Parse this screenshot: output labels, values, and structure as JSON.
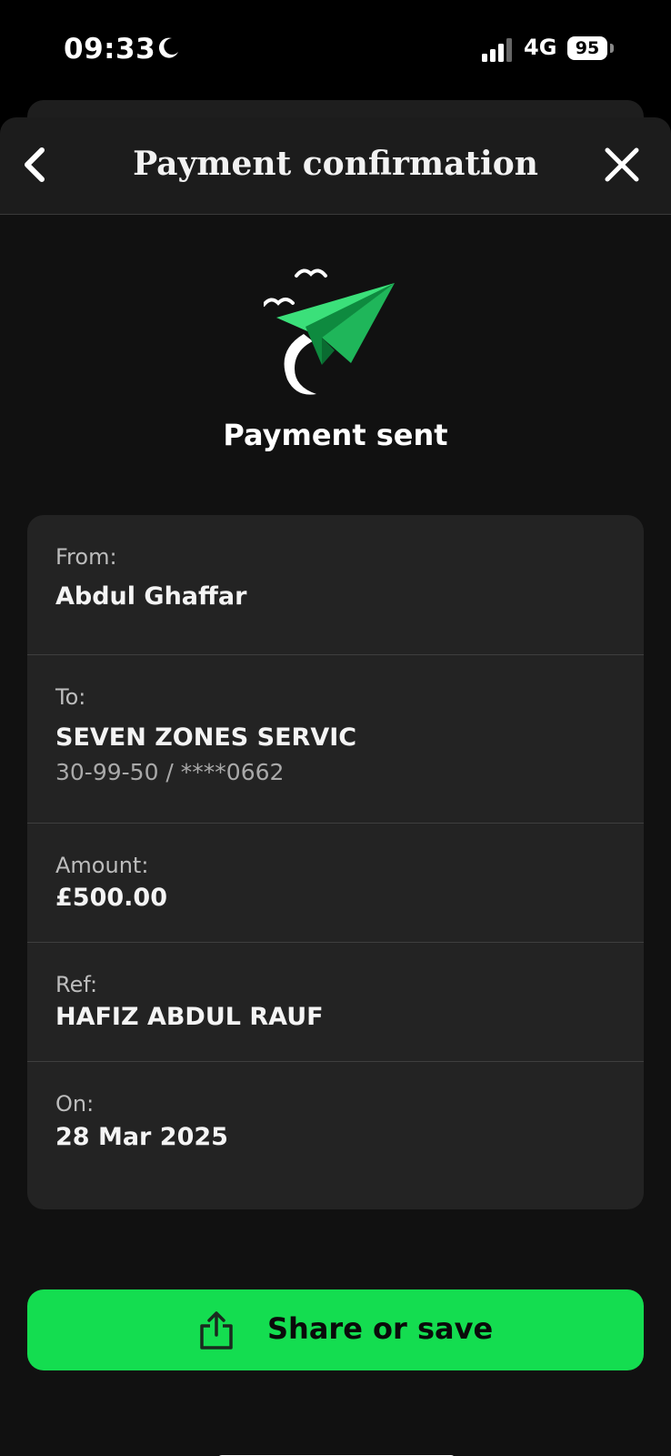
{
  "status": {
    "time": "09:33",
    "network": "4G",
    "battery": "95"
  },
  "header": {
    "title": "Payment confirmation"
  },
  "confirmation": {
    "title": "Payment sent"
  },
  "details": {
    "from_label": "From:",
    "from_value": "Abdul Ghaffar",
    "to_label": "To:",
    "to_value": "SEVEN ZONES SERVIC",
    "to_account": "30-99-50 / ****0662",
    "amount_label": "Amount:",
    "amount_value": "£500.00",
    "ref_label": "Ref:",
    "ref_value": "HAFIZ ABDUL RAUF",
    "on_label": "On:",
    "on_value": "28 Mar 2025"
  },
  "actions": {
    "share_label": "Share or save"
  },
  "icons": {
    "back": "chevron-left-icon",
    "close": "close-icon",
    "share": "share-icon",
    "illustration": "paper-plane-icon"
  },
  "colors": {
    "accent": "#14dd50",
    "plane_green": "#3be07a",
    "card_bg": "#232323"
  }
}
